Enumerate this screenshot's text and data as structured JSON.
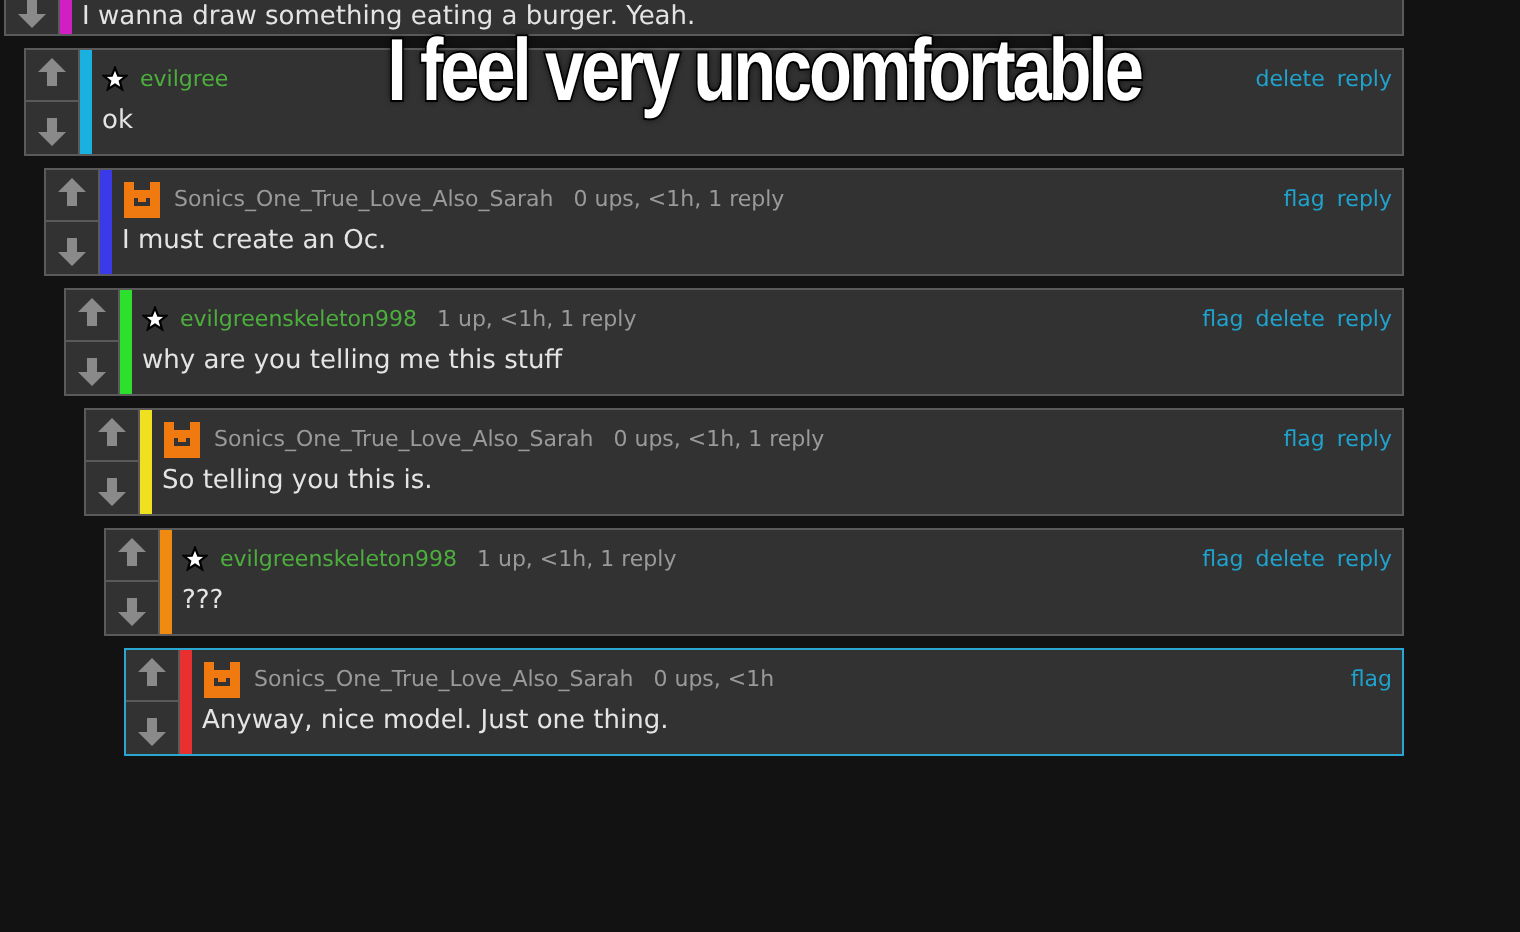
{
  "caption": "I feel very uncomfortable",
  "comments": [
    {
      "color": "#d21fc4",
      "highlighted": false,
      "body": "I wanna draw something eating a burger. Yeah.",
      "children": [
        {
          "color": "#1ab0e0",
          "highlighted": false,
          "kind": "star",
          "username": "evilgree",
          "actions": [
            "delete",
            "reply"
          ],
          "body": "ok",
          "children": [
            {
              "color": "#3a3ae8",
              "highlighted": false,
              "kind": "cat",
              "username": "Sonics_One_True_Love_Also_Sarah",
              "meta": "0 ups, <1h, 1 reply",
              "actions": [
                "flag",
                "reply"
              ],
              "body": "I must create an Oc.",
              "children": [
                {
                  "color": "#2ee02e",
                  "highlighted": false,
                  "kind": "star",
                  "username": "evilgreenskeleton998",
                  "meta": "1 up, <1h, 1 reply",
                  "actions": [
                    "flag",
                    "delete",
                    "reply"
                  ],
                  "body": "why are you telling me this stuff",
                  "children": [
                    {
                      "color": "#f0e020",
                      "highlighted": false,
                      "kind": "cat",
                      "username": "Sonics_One_True_Love_Also_Sarah",
                      "meta": "0 ups, <1h, 1 reply",
                      "actions": [
                        "flag",
                        "reply"
                      ],
                      "body": "So telling you this is.",
                      "children": [
                        {
                          "color": "#f08a10",
                          "highlighted": false,
                          "kind": "star",
                          "username": "evilgreenskeleton998",
                          "meta": "1 up, <1h, 1 reply",
                          "actions": [
                            "flag",
                            "delete",
                            "reply"
                          ],
                          "body": "???",
                          "children": [
                            {
                              "color": "#e83030",
                              "highlighted": true,
                              "kind": "cat",
                              "username": "Sonics_One_True_Love_Also_Sarah",
                              "meta": "0 ups, <1h",
                              "actions": [
                                "flag"
                              ],
                              "body": "Anyway, nice model. Just one thing."
                            }
                          ]
                        }
                      ]
                    }
                  ]
                }
              ]
            }
          ]
        }
      ]
    }
  ]
}
